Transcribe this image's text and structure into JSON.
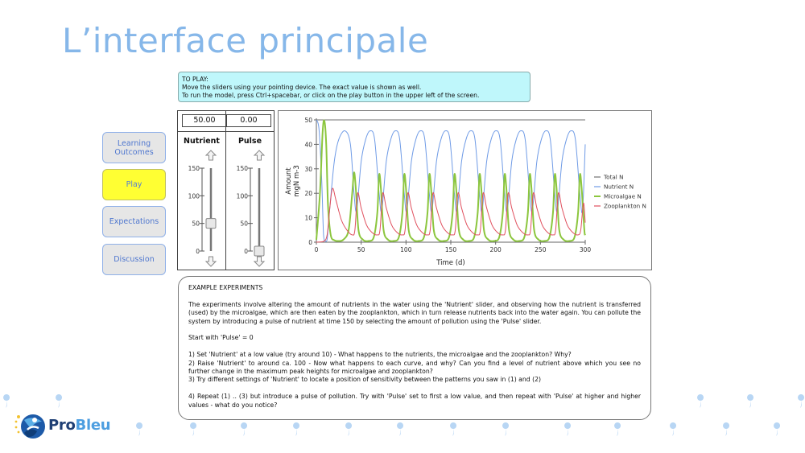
{
  "slide": {
    "title": "L’interface principale",
    "title_color": "#86b7e9"
  },
  "instructions": {
    "heading": "TO PLAY:",
    "line1": "Move the sliders using your pointing device. The exact value is shown as well.",
    "line2": "To run the model, press Ctrl+spacebar, or click on the play button in the upper left of the screen.",
    "background": "#bff7fb"
  },
  "nav": {
    "items": [
      {
        "label": "Learning Outcomes",
        "active": false
      },
      {
        "label": "Play",
        "active": true
      },
      {
        "label": "Expectations",
        "active": false
      },
      {
        "label": "Discussion",
        "active": false
      }
    ]
  },
  "sliders": [
    {
      "label": "Nutrient",
      "value_text": "50.00",
      "value": 50,
      "min": 0,
      "max": 150,
      "ticks": [
        "150",
        "100",
        "50",
        "0"
      ]
    },
    {
      "label": "Pulse",
      "value_text": "0.00",
      "value": 0,
      "min": 0,
      "max": 150,
      "ticks": [
        "150",
        "100",
        "50",
        "0"
      ]
    }
  ],
  "chart_data": {
    "type": "line",
    "title": "",
    "xlabel": "Time (d)",
    "ylabel": "Amount mgN m-3",
    "ylabel_lines": [
      "Amount",
      "mgN m-3"
    ],
    "xlim": [
      0,
      300
    ],
    "ylim": [
      0,
      50
    ],
    "xticks": [
      "0",
      "50",
      "100",
      "150",
      "200",
      "250",
      "300"
    ],
    "yticks": [
      "0",
      "10",
      "20",
      "30",
      "40",
      "50"
    ],
    "grid": false,
    "legend_position": "right",
    "series": [
      {
        "name": "Total N",
        "color": "#707070",
        "x": [
          0,
          300
        ],
        "y": [
          50,
          50
        ]
      },
      {
        "name": "Nutrient N",
        "color": "#6f9be6",
        "x": [
          0,
          3,
          6,
          8,
          10,
          12,
          15,
          20,
          25,
          32,
          38,
          42,
          45,
          50,
          55,
          60,
          65,
          70,
          73,
          78,
          83,
          88,
          93,
          98,
          101,
          106,
          111,
          116,
          121,
          126,
          129,
          134,
          139,
          144,
          149,
          154,
          157,
          162,
          167,
          172,
          177,
          182,
          185,
          190,
          195,
          200,
          205,
          210,
          213,
          218,
          223,
          228,
          233,
          238,
          241,
          246,
          251,
          256,
          261,
          266,
          269,
          274,
          279,
          284,
          289,
          294,
          297,
          300
        ],
        "y": [
          50,
          46,
          25,
          3,
          0.5,
          1,
          14,
          33,
          42,
          45.5,
          40,
          20,
          13,
          33,
          42,
          45.5,
          42,
          20,
          13,
          33,
          42,
          45.5,
          42,
          20,
          13,
          33,
          42,
          45.5,
          42,
          20,
          13,
          33,
          42,
          45.5,
          42,
          20,
          13,
          33,
          42,
          45.5,
          42,
          20,
          13,
          33,
          42,
          45.5,
          42,
          20,
          13,
          33,
          42,
          45.5,
          42,
          20,
          13,
          33,
          42,
          45.5,
          42,
          20,
          13,
          33,
          42,
          45.5,
          42,
          20,
          13,
          40
        ]
      },
      {
        "name": "Microalgae N",
        "color": "#8cc63e",
        "x": [
          0,
          4,
          7,
          9,
          11,
          13,
          16,
          20,
          25,
          30,
          36,
          40,
          42,
          44,
          47,
          52,
          58,
          64,
          68,
          70,
          72,
          75,
          80,
          86,
          92,
          96,
          98,
          100,
          103,
          108,
          114,
          120,
          124,
          126,
          128,
          131,
          136,
          142,
          148,
          152,
          154,
          156,
          159,
          164,
          170,
          176,
          180,
          182,
          184,
          187,
          192,
          198,
          204,
          208,
          210,
          212,
          215,
          220,
          226,
          232,
          236,
          238,
          240,
          243,
          248,
          254,
          260,
          264,
          266,
          268,
          271,
          276,
          282,
          288,
          292,
          294,
          296,
          299,
          300
        ],
        "y": [
          1,
          20,
          45,
          49.5,
          40,
          15,
          3,
          0.8,
          0.5,
          1,
          5,
          20,
          28.5,
          22,
          5,
          1,
          0.5,
          2,
          12,
          27.5,
          22,
          5,
          1,
          0.5,
          2,
          12,
          27.5,
          22,
          5,
          1,
          0.5,
          2,
          12,
          27.5,
          22,
          5,
          1,
          0.5,
          2,
          12,
          27.5,
          22,
          5,
          1,
          0.5,
          2,
          12,
          27.5,
          22,
          5,
          1,
          0.5,
          2,
          12,
          27.5,
          22,
          5,
          1,
          0.5,
          2,
          12,
          27.5,
          22,
          5,
          1,
          0.5,
          2,
          12,
          27.5,
          22,
          5,
          1,
          0.5,
          2,
          12,
          27.5,
          22,
          5,
          3
        ]
      },
      {
        "name": "Zooplankton N",
        "color": "#e0505e",
        "x": [
          0,
          8,
          12,
          15,
          18,
          22,
          28,
          34,
          40,
          43,
          46,
          50,
          56,
          62,
          68,
          71,
          74,
          78,
          84,
          90,
          96,
          99,
          102,
          106,
          112,
          118,
          124,
          127,
          130,
          134,
          140,
          146,
          152,
          155,
          158,
          162,
          168,
          174,
          180,
          183,
          186,
          190,
          196,
          202,
          208,
          211,
          214,
          218,
          224,
          230,
          236,
          239,
          242,
          246,
          252,
          258,
          264,
          267,
          270,
          274,
          280,
          286,
          292,
          295,
          298,
          300
        ],
        "y": [
          0,
          0.3,
          3,
          14,
          22,
          17,
          9,
          5,
          3,
          5,
          20,
          14,
          7,
          4,
          3,
          5,
          20,
          14,
          7,
          4,
          3,
          5,
          20,
          14,
          7,
          4,
          3,
          5,
          20,
          14,
          7,
          4,
          3,
          5,
          20,
          14,
          7,
          4,
          3,
          5,
          20,
          14,
          7,
          4,
          3,
          5,
          20,
          14,
          7,
          4,
          3,
          5,
          20,
          14,
          7,
          4,
          3,
          5,
          20,
          14,
          7,
          4,
          3,
          5,
          16,
          8
        ]
      }
    ]
  },
  "experiments": {
    "heading": "EXAMPLE EXPERIMENTS",
    "intro": "The experiments involve altering the amount of nutrients in the water using the 'Nutrient' slider, and observing how the nutrient is transferred (used) by the microalgae, which are then eaten by the zooplankton, which in turn release nutrients back into the water again. You can pollute the system by introducing a pulse of nutrient at time 150 by selecting the amount of pollution using the 'Pulse' slider.",
    "start": "Start with 'Pulse' = 0",
    "step1": "1) Set 'Nutrient' at a low value (try around 10) - What happens to the nutrients, the microalgae and the zooplankton? Why?",
    "step2": "2) Raise 'Nutrient' to around ca. 100 - Now what happens to each curve, and why? Can you find a level of nutrient above which you see no further change in the maximum peak heights for microalgae and zooplankton?",
    "step3": "3) Try different settings of 'Nutrient' to locate a position of sensitivity between the patterns you saw in (1) and (2)",
    "step4": "4) Repeat (1) .. (3) but introduce a pulse of pollution. Try with 'Pulse' set to first a low value, and then repeat with 'Pulse' at higher and higher values - what do you notice?"
  },
  "logo": {
    "text_dark": "Pro",
    "text_light": "Bleu",
    "color_dark": "#1f3f74",
    "color_light": "#4d9ee0"
  }
}
